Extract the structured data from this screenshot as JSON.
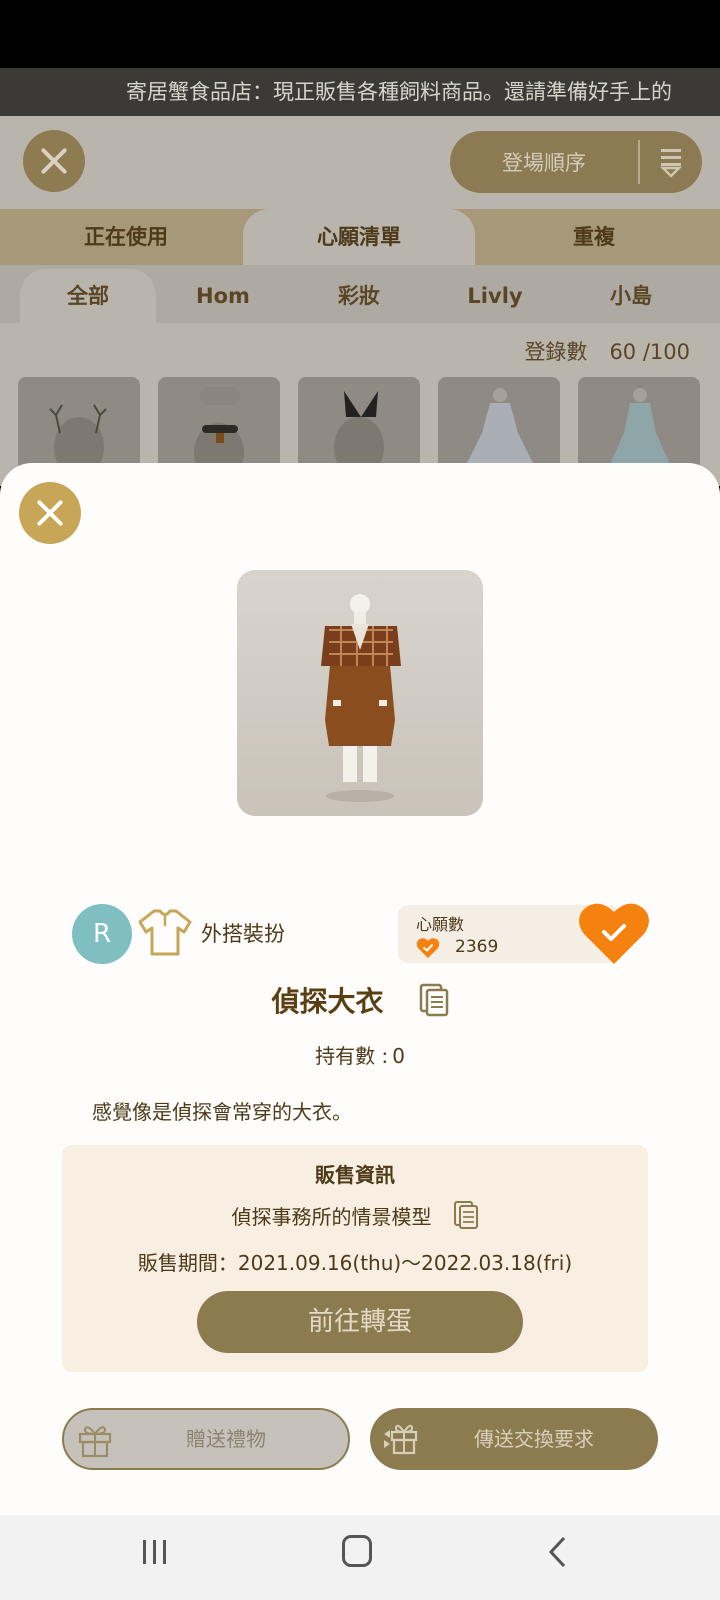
{
  "ticker": {
    "text": "寄居蟹食品店：現正販售各種飼料商品。還請準備好手上的"
  },
  "header": {
    "sort_label": "登場順序"
  },
  "tabs": [
    {
      "label": "正在使用"
    },
    {
      "label": "心願清單"
    },
    {
      "label": "重複"
    }
  ],
  "subtabs": [
    {
      "label": "全部"
    },
    {
      "label": "Hom"
    },
    {
      "label": "彩妝"
    },
    {
      "label": "Livly"
    },
    {
      "label": "小島"
    }
  ],
  "registration": {
    "label": "登錄數",
    "value": "60 /100"
  },
  "item": {
    "rarity": "R",
    "category_icon": "shirt-icon",
    "category": "外搭裝扮",
    "wish_label": "心願數",
    "wish_count": "2369",
    "name": "偵探大衣",
    "owned_label": "持有數 :",
    "owned_value": "0",
    "description": "感覺像是偵探會常穿的大衣。"
  },
  "sale": {
    "title": "販售資訊",
    "source": "偵探事務所的情景模型",
    "period": "販售期間：2021.09.16(thu)～2022.03.18(fri)",
    "gacha_button": "前往轉蛋"
  },
  "actions": {
    "gift": "贈送禮物",
    "trade": "傳送交換要求"
  },
  "colors": {
    "accent_gold": "#c7a658",
    "button_brown": "#8d7b50",
    "heart_orange": "#f5820f",
    "rarity_teal": "#7fbfc2"
  }
}
